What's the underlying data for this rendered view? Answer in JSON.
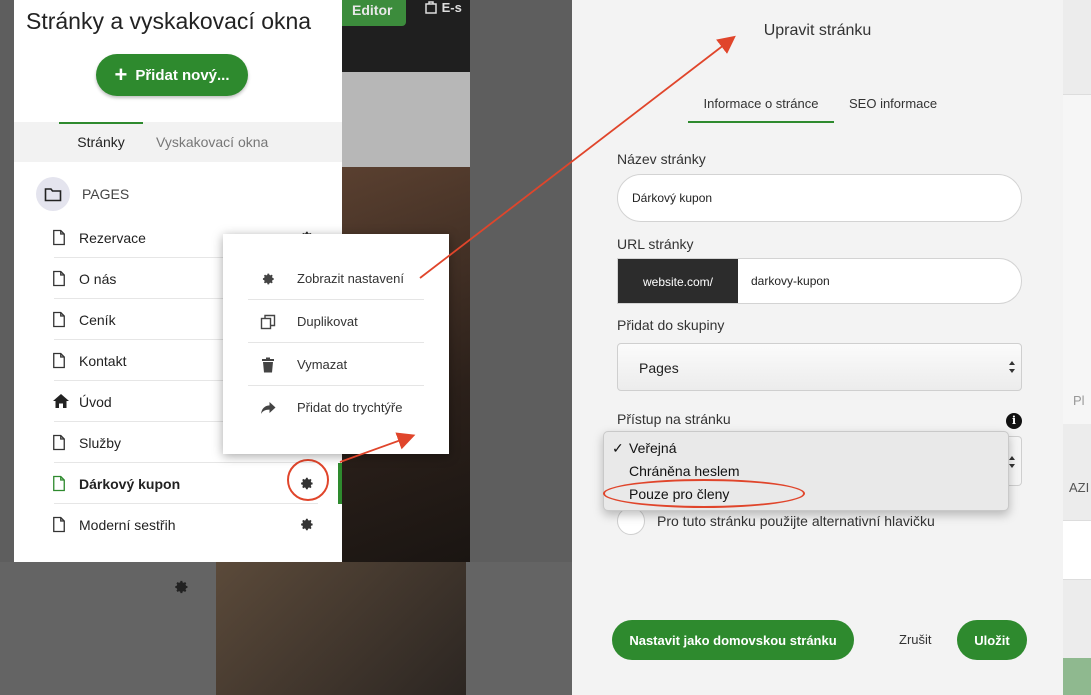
{
  "background": {
    "editor_button": "Editor",
    "eshop_label": "E-s"
  },
  "left_panel": {
    "title": "Stránky a vyskakovací okna",
    "add_button": "Přidat nový...",
    "tabs": {
      "pages": "Stránky",
      "popups": "Vyskakovací okna"
    },
    "folder_label": "PAGES",
    "items": [
      {
        "label": "Rezervace",
        "icon": "page-icon"
      },
      {
        "label": "O nás",
        "icon": "page-icon"
      },
      {
        "label": "Ceník",
        "icon": "page-icon"
      },
      {
        "label": "Kontakt",
        "icon": "page-icon"
      },
      {
        "label": "Úvod",
        "icon": "home-icon"
      },
      {
        "label": "Služby",
        "icon": "page-icon"
      },
      {
        "label": "Dárkový kupon",
        "icon": "page-icon",
        "active": true
      },
      {
        "label": "Moderní sestřih",
        "icon": "page-icon"
      }
    ]
  },
  "context_menu": {
    "items": [
      {
        "label": "Zobrazit nastavení",
        "icon": "gear-icon"
      },
      {
        "label": "Duplikovat",
        "icon": "duplicate-icon"
      },
      {
        "label": "Vymazat",
        "icon": "trash-icon"
      },
      {
        "label": "Přidat do trychtýře",
        "icon": "share-arrow-icon"
      }
    ]
  },
  "modal": {
    "title": "Upravit stránku",
    "tabs": {
      "info": "Informace o stránce",
      "seo": "SEO informace"
    },
    "name_label": "Název stránky",
    "name_value": "Dárkový kupon",
    "url_label": "URL stránky",
    "url_prefix": "website.com/",
    "url_value": "darkovy-kupon",
    "group_label": "Přidat do skupiny",
    "group_value": "Pages",
    "access_label": "Přístup na stránku",
    "access_options": [
      "Veřejná",
      "Chráněna heslem",
      "Pouze pro členy"
    ],
    "access_selected": "Veřejná",
    "check_mark": "✓",
    "alt_header_label": "Pro tuto stránku použijte alternativní hlavičku",
    "home_button": "Nastavit jako domovskou stránku",
    "cancel_button": "Zrušit",
    "save_button": "Uložit"
  },
  "right_edge": {
    "p_text": "Pl",
    "a_text": "AZI"
  },
  "colors": {
    "accent_green": "#2e8a2e",
    "annotation_red": "#e0452b",
    "url_prefix_bg": "#2c2c2c"
  }
}
